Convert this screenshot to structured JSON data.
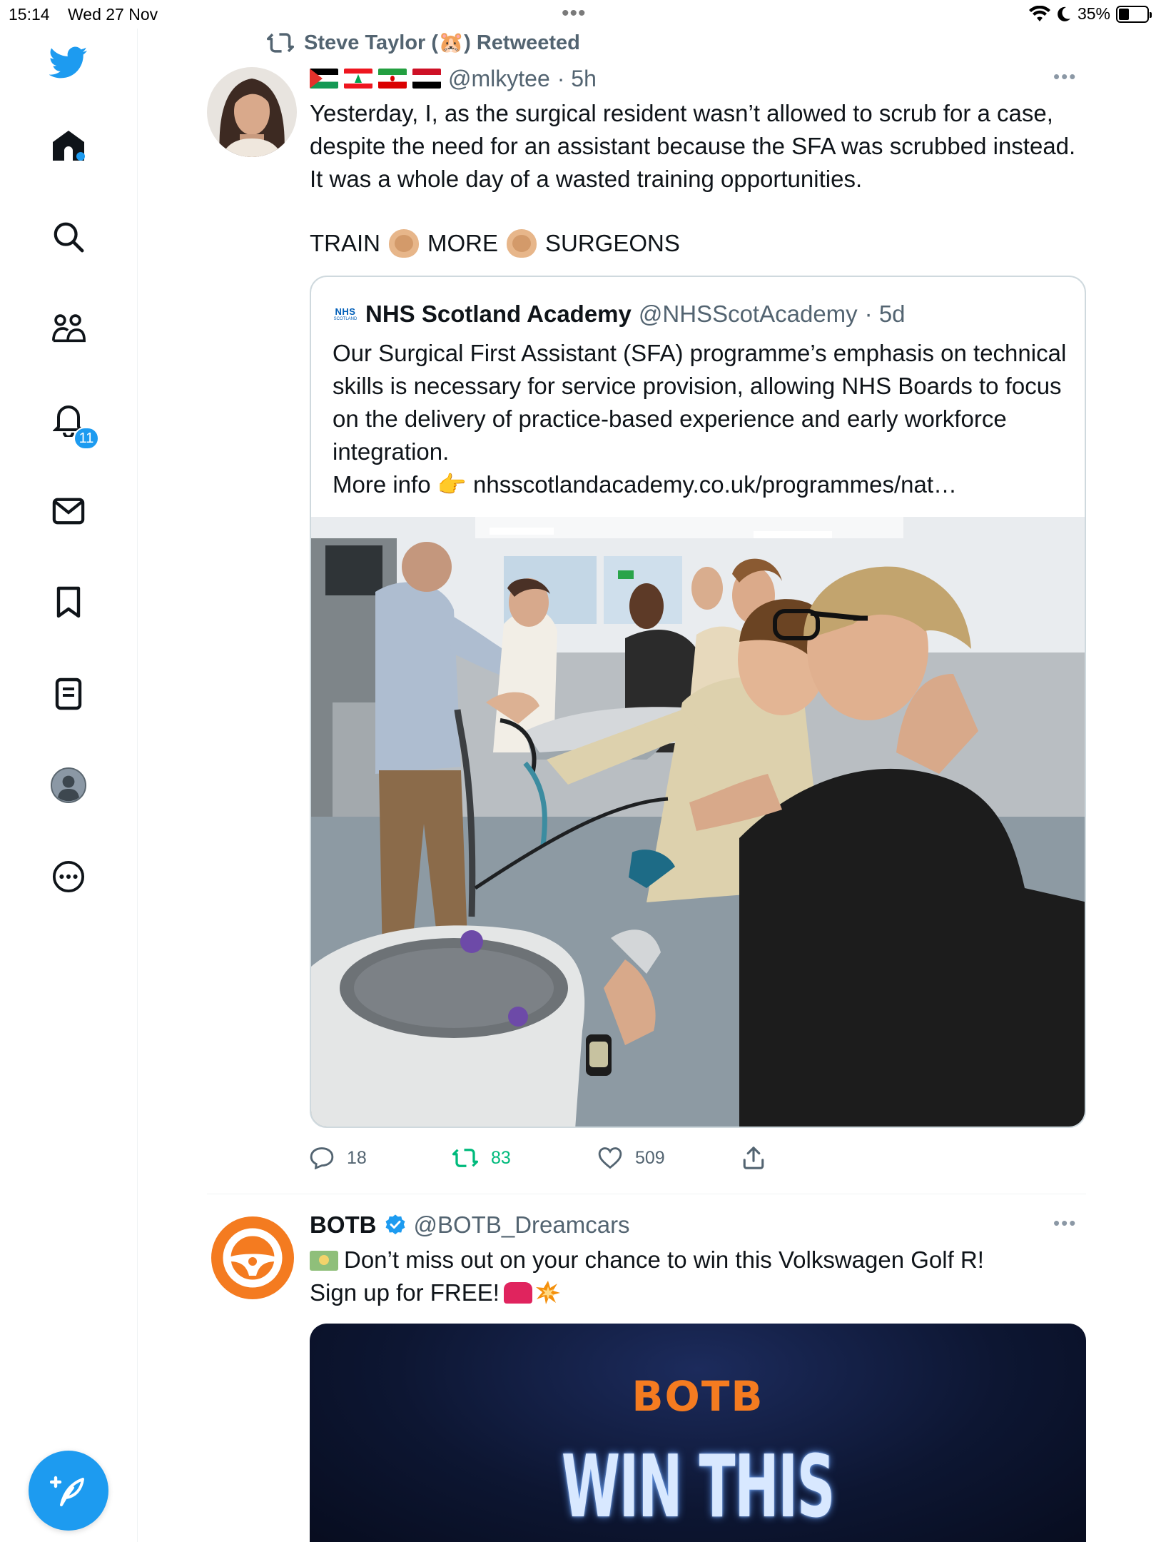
{
  "status_bar": {
    "time": "15:14",
    "date": "Wed 27 Nov",
    "battery": "35%"
  },
  "sidebar": {
    "items": [
      {
        "name": "home",
        "icon": "home-icon"
      },
      {
        "name": "explore",
        "icon": "search-icon"
      },
      {
        "name": "communities",
        "icon": "communities-icon"
      },
      {
        "name": "notifications",
        "icon": "bell-icon",
        "badge": "11"
      },
      {
        "name": "messages",
        "icon": "envelope-icon"
      },
      {
        "name": "bookmarks",
        "icon": "bookmark-icon"
      },
      {
        "name": "lists",
        "icon": "list-icon"
      },
      {
        "name": "profile",
        "icon": "profile-avatar-icon"
      },
      {
        "name": "more",
        "icon": "more-circle-icon"
      }
    ],
    "compose_icon": "compose-feather-icon"
  },
  "tweet1": {
    "retweeted_by": "Steve Taylor (🐹) Retweeted",
    "handle": "@mlkytee",
    "time": "· 5h",
    "text": "Yesterday, I, as the surgical resident wasn’t allowed to scrub for a case, despite the need for an assistant because the SFA was scrubbed instead. It was a whole day of a wasted training opportunities.",
    "shout": [
      "TRAIN",
      "MORE",
      "SURGEONS"
    ],
    "quote": {
      "name": "NHS Scotland Academy",
      "handle": "@NHSScotAcademy",
      "time": "· 5d",
      "logo_text": "NHS",
      "logo_sub": "SCOTLAND",
      "text": "Our Surgical First Assistant (SFA) programme’s emphasis on technical skills is necessary for service provision, allowing NHS Boards to focus on the delivery of practice-based experience and early workforce integration.",
      "more_info_label": "More info 👉",
      "link": "nhsscotlandacademy.co.uk/programmes/nat…"
    },
    "actions": {
      "replies": "18",
      "retweets": "83",
      "likes": "509"
    }
  },
  "tweet2": {
    "name": "BOTB",
    "handle": "@BOTB_Dreamcars",
    "text_line1": "Don’t miss out on your chance to win this Volkswagen Golf R!",
    "text_line2": "Sign up for FREE!",
    "promo_logo": "BOTB",
    "promo_title": "WIN THIS"
  },
  "colors": {
    "accent": "#1d9bf0",
    "retweet_green": "#00ba7c",
    "secondary_text": "#536471",
    "botb_orange": "#f47b20"
  }
}
